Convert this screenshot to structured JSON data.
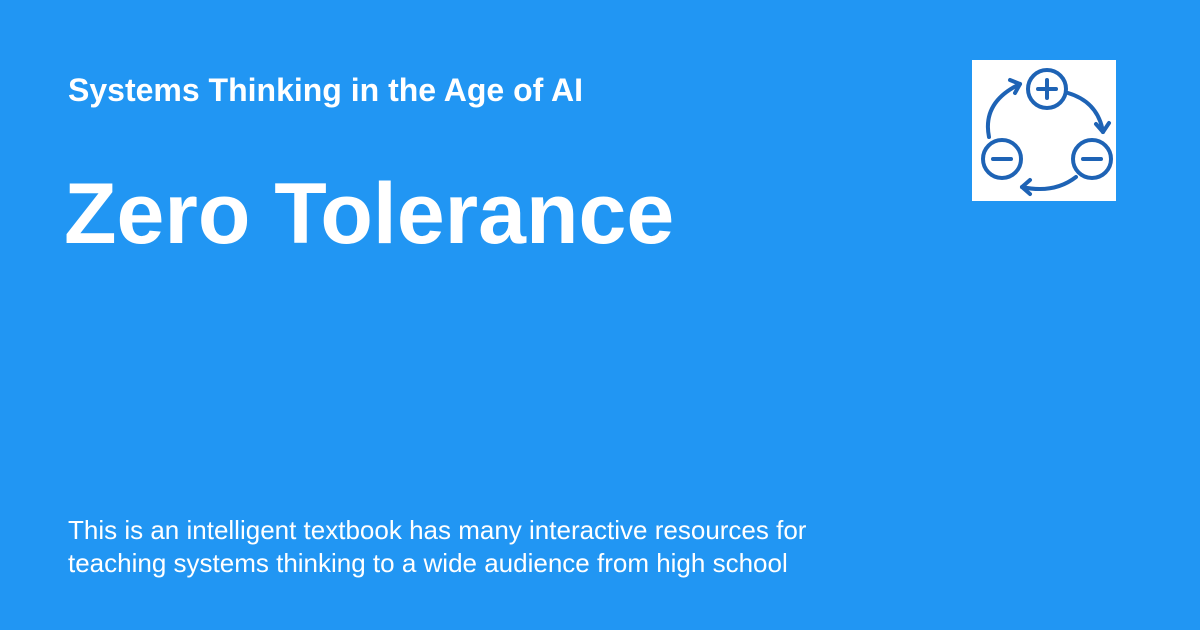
{
  "header": {
    "site_title": "Systems Thinking in the Age of AI"
  },
  "main": {
    "page_title": "Zero Tolerance",
    "description_lines": [
      "This is an intelligent textbook has many interactive resources for",
      "teaching systems thinking to a wide audience from high school"
    ]
  },
  "logo": {
    "icon": "feedback-loop-icon",
    "color": "#1e63b5"
  },
  "colors": {
    "background": "#2196f3",
    "text": "#ffffff",
    "logo_background": "#ffffff"
  }
}
